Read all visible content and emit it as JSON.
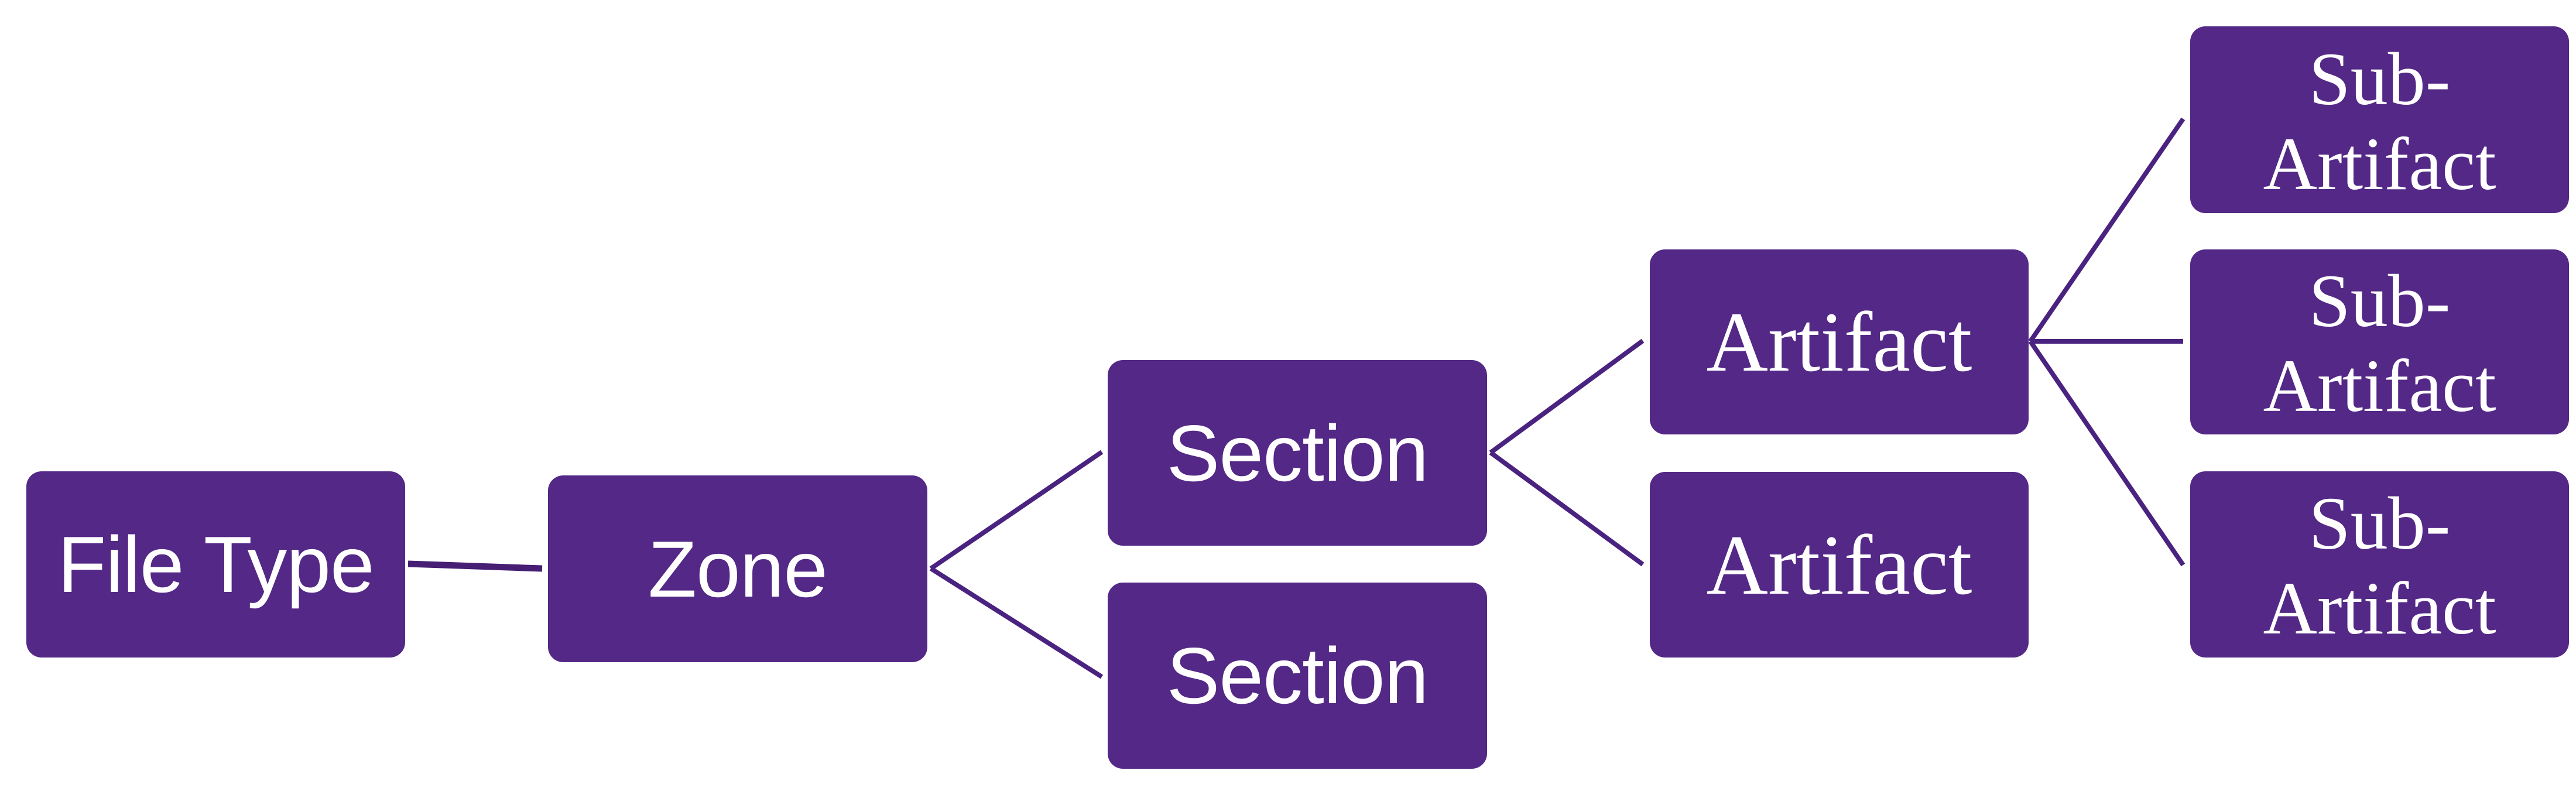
{
  "diagram": {
    "title": "",
    "colors": {
      "node_fill": "#532886",
      "connector": "#4a2280",
      "text": "#ffffff",
      "background": "#ffffff"
    },
    "nodes": {
      "file_type": {
        "label": "File Type",
        "level": 1
      },
      "zone": {
        "label": "Zone",
        "level": 2
      },
      "section_1": {
        "label": "Section",
        "level": 3
      },
      "section_2": {
        "label": "Section",
        "level": 3
      },
      "artifact_1": {
        "label": "Artifact",
        "level": 4
      },
      "artifact_2": {
        "label": "Artifact",
        "level": 4
      },
      "sub_artifact_1": {
        "label": "Sub-\nArtifact",
        "level": 5
      },
      "sub_artifact_2": {
        "label": "Sub-\nArtifact",
        "level": 5
      },
      "sub_artifact_3": {
        "label": "Sub-\nArtifact",
        "level": 5
      }
    },
    "edges": [
      {
        "from": "file_type",
        "to": "zone"
      },
      {
        "from": "zone",
        "to": "section_1"
      },
      {
        "from": "zone",
        "to": "section_2"
      },
      {
        "from": "section_1",
        "to": "artifact_1"
      },
      {
        "from": "section_1",
        "to": "artifact_2"
      },
      {
        "from": "artifact_1",
        "to": "sub_artifact_1"
      },
      {
        "from": "artifact_1",
        "to": "sub_artifact_2"
      },
      {
        "from": "artifact_1",
        "to": "sub_artifact_3"
      }
    ]
  }
}
